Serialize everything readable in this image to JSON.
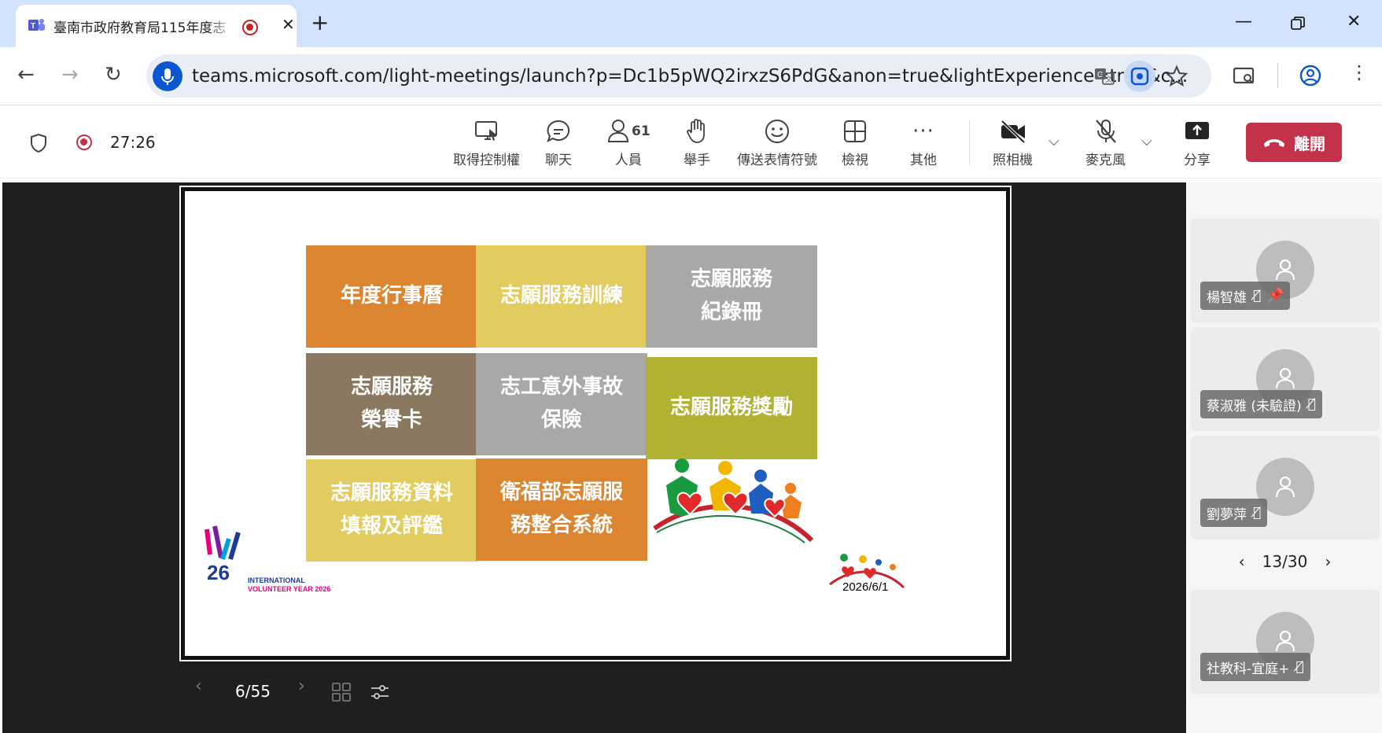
{
  "browser": {
    "tab_title": "臺南市政府教育局115年度志",
    "url": "teams.microsoft.com/light-meetings/launch?p=Dc1b5pWQ2irxzS6PdG&anon=true&lightExperience=true&c..."
  },
  "meeting": {
    "elapsed": "27:26",
    "participant_count": "61",
    "toolbar": {
      "take_control": "取得控制權",
      "chat": "聊天",
      "people": "人員",
      "raise_hand": "舉手",
      "reactions": "傳送表情符號",
      "view": "檢視",
      "more": "其他",
      "camera": "照相機",
      "mic": "麥克風",
      "share": "分享",
      "leave": "離開"
    }
  },
  "slide": {
    "tiles": [
      {
        "lines": [
          "年度行事曆"
        ],
        "color": "#dc8531"
      },
      {
        "lines": [
          "志願服務訓練"
        ],
        "color": "#e2cc5f"
      },
      {
        "lines": [
          "志願服務",
          "紀錄冊"
        ],
        "color": "#a8a8a6"
      },
      {
        "lines": [
          "志願服務",
          "榮譽卡"
        ],
        "color": "#8b7861"
      },
      {
        "lines": [
          "志工意外事故",
          "保險"
        ],
        "color": "#a8a8a6"
      },
      {
        "lines": [
          "志願服務獎勵"
        ],
        "color": "#b1b132"
      },
      {
        "lines": [
          "志願服務資料",
          "填報及評鑑"
        ],
        "color": "#e2cc5f"
      },
      {
        "lines": [
          "衛福部志願服",
          "務整合系統"
        ],
        "color": "#dc8531"
      }
    ],
    "logo_text_1": "INTERNATIONAL",
    "logo_text_2": "VOLUNTEER YEAR 2026",
    "logo_mark": "26",
    "date": "2026/6/1"
  },
  "slide_nav": {
    "page": "6/55"
  },
  "participants": [
    {
      "name": "楊智雄"
    },
    {
      "name": "蔡淑雅 (未驗證)"
    },
    {
      "name": "劉夢萍"
    },
    {
      "name": "社教科-宜庭+"
    }
  ],
  "participant_pager": "13/30"
}
